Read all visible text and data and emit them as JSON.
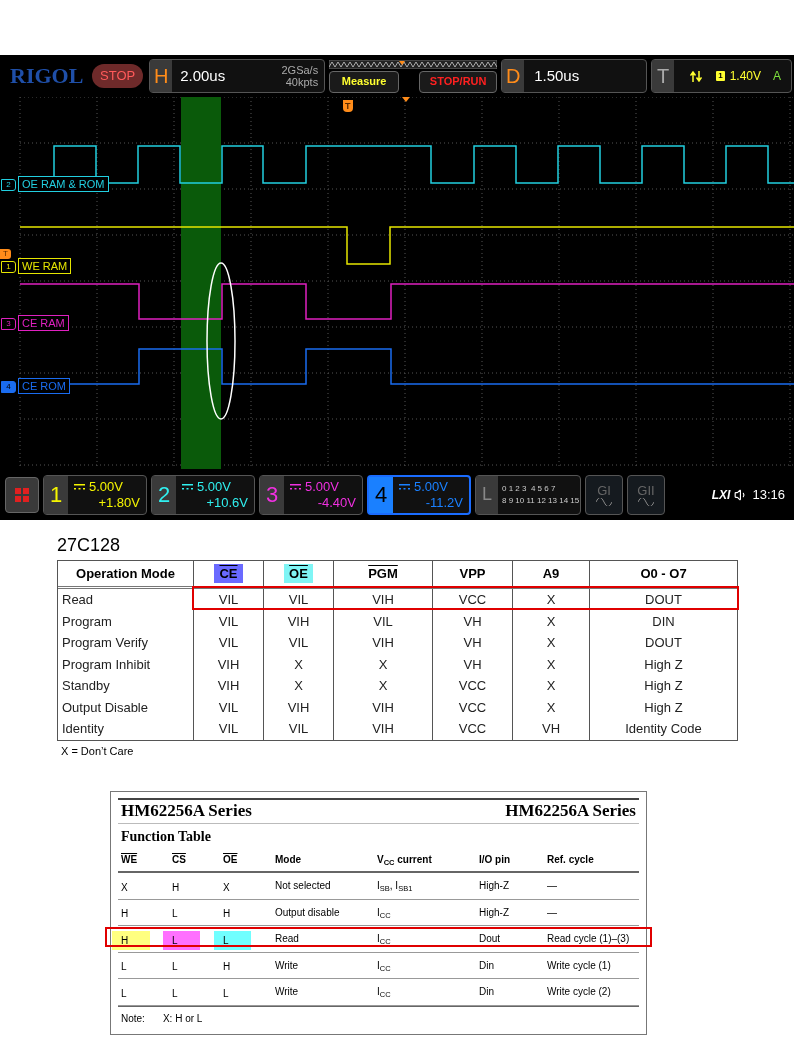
{
  "scope": {
    "brand": "RIGOL",
    "run_state": "STOP",
    "horizontal": {
      "letter": "H",
      "timebase": "2.00us",
      "sample_rate": "2GSa/s",
      "memory_depth": "40kpts"
    },
    "buttons": [
      {
        "label": "Measure",
        "kind": "measure"
      },
      {
        "label": "STOP/RUN",
        "kind": "run"
      }
    ],
    "delay": {
      "letter": "D",
      "value": "1.50us"
    },
    "trigger": {
      "letter": "T",
      "source": "1",
      "level": "1.40V",
      "mode": "A"
    },
    "trigger_position": "T",
    "trigger_level_marker": "T",
    "traces": [
      {
        "number": "2",
        "label": "OE RAM & ROM",
        "color": "#22cfe0",
        "active": false
      },
      {
        "number": "1",
        "label": "WE RAM",
        "color": "#e6e600",
        "active": false
      },
      {
        "number": "3",
        "label": "CE RAM",
        "color": "#e020c0",
        "active": false
      },
      {
        "number": "4",
        "label": "CE ROM",
        "color": "#1a6cf0",
        "active": true
      }
    ],
    "channels": [
      {
        "number": "1",
        "scale": "5.00V",
        "offset": "+1.80V",
        "color": "#f5f500",
        "selected": false
      },
      {
        "number": "2",
        "scale": "5.00V",
        "offset": "+10.6V",
        "color": "#30f0f0",
        "selected": false
      },
      {
        "number": "3",
        "scale": "5.00V",
        "offset": "-4.40V",
        "color": "#f030e0",
        "selected": false
      },
      {
        "number": "4",
        "scale": "5.00V",
        "offset": "-11.2V",
        "color": "#1a80ff",
        "selected": true
      }
    ],
    "logic": {
      "letter": "L",
      "rows": [
        "0 1 2 3  4 5 6 7",
        "8 9 10 11 12 13 14 15"
      ]
    },
    "generators": [
      "GI",
      "GII"
    ],
    "lxi": "LXI",
    "time": "13:16"
  },
  "eprom_table": {
    "title": "27C128",
    "columns": [
      {
        "label": "Operation Mode",
        "overline": false
      },
      {
        "label": "CE",
        "overline": true,
        "color": "#6a6aff"
      },
      {
        "label": "OE",
        "overline": true,
        "color": "#7ff5f5"
      },
      {
        "label": "PGM",
        "overline": true
      },
      {
        "label": "VPP",
        "overline": false
      },
      {
        "label": "A9",
        "overline": false
      },
      {
        "label": "O0 - O7",
        "overline": false
      }
    ],
    "rows": [
      {
        "cells": [
          "Read",
          "VIL",
          "VIL",
          "VIH",
          "VCC",
          "X",
          "DOUT"
        ],
        "selected": true
      },
      {
        "cells": [
          "Program",
          "VIL",
          "VIH",
          "VIL",
          "VH",
          "X",
          "DIN"
        ],
        "selected": false
      },
      {
        "cells": [
          "Program Verify",
          "VIL",
          "VIL",
          "VIH",
          "VH",
          "X",
          "DOUT"
        ],
        "selected": false
      },
      {
        "cells": [
          "Program Inhibit",
          "VIH",
          "X",
          "X",
          "VH",
          "X",
          "High Z"
        ],
        "selected": false
      },
      {
        "cells": [
          "Standby",
          "VIH",
          "X",
          "X",
          "VCC",
          "X",
          "High Z"
        ],
        "selected": false
      },
      {
        "cells": [
          "Output Disable",
          "VIL",
          "VIH",
          "VIH",
          "VCC",
          "X",
          "High Z"
        ],
        "selected": false
      },
      {
        "cells": [
          "Identity",
          "VIL",
          "VIL",
          "VIH",
          "VCC",
          "VH",
          "Identity Code"
        ],
        "selected": false
      }
    ],
    "note": "X = Don’t Care"
  },
  "sram_table": {
    "header_left": "HM62256A Series",
    "header_right": "HM62256A Series",
    "title": "Function Table",
    "columns": [
      {
        "label": "WE",
        "overline": true
      },
      {
        "label": "CS",
        "overline": true
      },
      {
        "label": "OE",
        "overline": true
      },
      {
        "label": "Mode",
        "overline": false
      },
      {
        "label": "V$_{CC}$ current",
        "overline": false
      },
      {
        "label": "I/O pin",
        "overline": false
      },
      {
        "label": "Ref. cycle",
        "overline": false
      }
    ],
    "rows": [
      {
        "signals": [
          {
            "text": "X"
          },
          {
            "text": "H"
          },
          {
            "text": "X"
          }
        ],
        "mode": "Not selected",
        "current": "I$_{SB}$, I$_{SB1}$",
        "io_pin": "High-Z",
        "ref_cycle": "—",
        "selected": false
      },
      {
        "signals": [
          {
            "text": "H"
          },
          {
            "text": "L"
          },
          {
            "text": "H"
          }
        ],
        "mode": "Output disable",
        "current": "I$_{CC}$",
        "io_pin": "High-Z",
        "ref_cycle": "—",
        "selected": false
      },
      {
        "signals": [
          {
            "text": "H",
            "color": "#ffff80"
          },
          {
            "text": "L",
            "color": "#ff70ff"
          },
          {
            "text": "L",
            "color": "#70ffff"
          }
        ],
        "mode": "Read",
        "current": "I$_{CC}$",
        "io_pin": "Dout",
        "ref_cycle": "Read cycle (1)–(3)",
        "selected": true
      },
      {
        "signals": [
          {
            "text": "L"
          },
          {
            "text": "L"
          },
          {
            "text": "H"
          }
        ],
        "mode": "Write",
        "current": "I$_{CC}$",
        "io_pin": "Din",
        "ref_cycle": "Write cycle (1)",
        "selected": false
      },
      {
        "signals": [
          {
            "text": "L"
          },
          {
            "text": "L"
          },
          {
            "text": "L"
          }
        ],
        "mode": "Write",
        "current": "I$_{CC}$",
        "io_pin": "Din",
        "ref_cycle": "Write cycle (2)",
        "selected": false
      }
    ],
    "note_label": "Note:",
    "note": "X: H or L"
  }
}
